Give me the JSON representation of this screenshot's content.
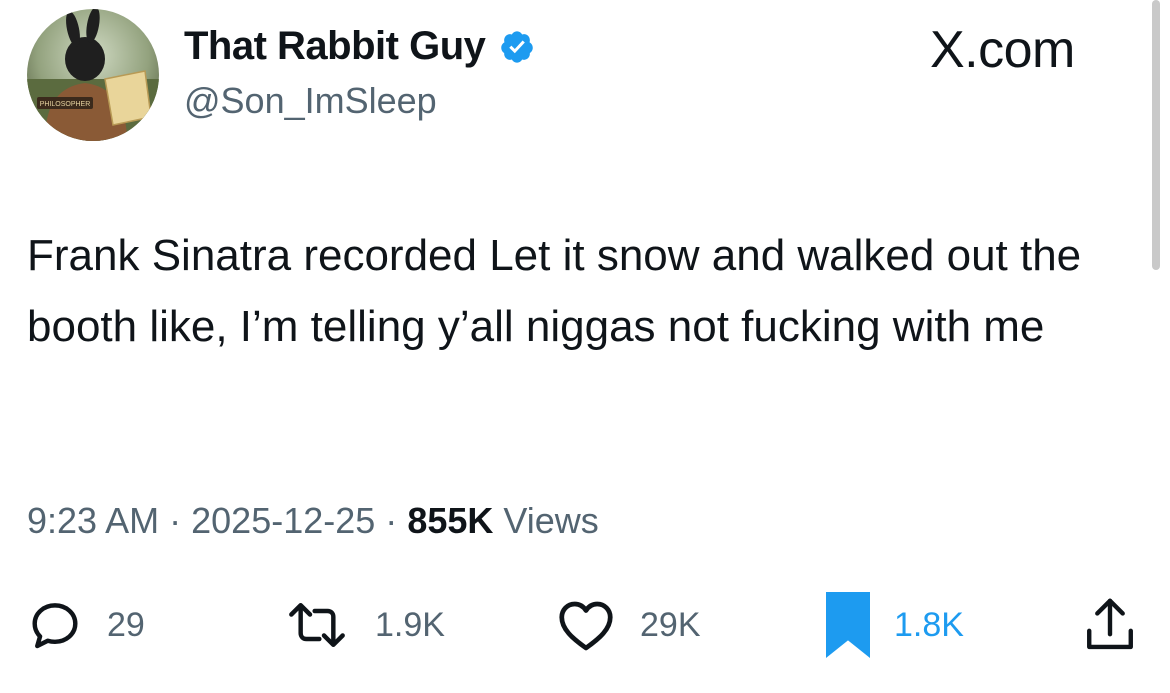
{
  "tweet": {
    "author": {
      "display_name": "That Rabbit Guy",
      "handle": "@Son_ImSleep",
      "verified": true,
      "avatar_sign": "PHILOSOPHER"
    },
    "brand": "X.com",
    "text": "Frank Sinatra recorded Let it snow and walked out the booth like, I’m telling y’all niggas not fucking with me",
    "time": "9:23 AM",
    "separator": "·",
    "date": "2025-12-25",
    "views_count": "855K",
    "views_label": "Views"
  },
  "actions": {
    "replies": "29",
    "reposts": "1.9K",
    "likes": "29K",
    "bookmarks": "1.8K"
  },
  "colors": {
    "text": "#0f1419",
    "muted": "#536471",
    "accent": "#1d9bf0"
  },
  "icons": [
    "verified-badge-icon",
    "reply-icon",
    "repost-icon",
    "like-icon",
    "bookmark-icon",
    "share-icon"
  ]
}
